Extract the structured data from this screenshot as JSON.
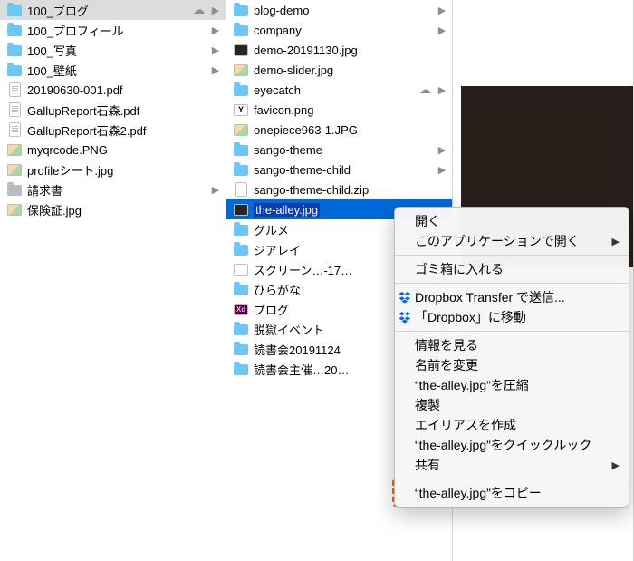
{
  "col1": {
    "items": [
      {
        "type": "folder",
        "label": "100_ブログ",
        "cloud": true,
        "arrow": true,
        "selected": "gray"
      },
      {
        "type": "folder",
        "label": "100_プロフィール",
        "arrow": true
      },
      {
        "type": "folder",
        "label": "100_写真",
        "arrow": true
      },
      {
        "type": "folder",
        "label": "100_壁紙",
        "arrow": true
      },
      {
        "type": "file",
        "label": "20190630-001.pdf"
      },
      {
        "type": "file",
        "label": "GallupReport石森.pdf"
      },
      {
        "type": "file",
        "label": "GallupReport石森2.pdf"
      },
      {
        "type": "img",
        "label": "myqrcode.PNG"
      },
      {
        "type": "img",
        "label": "profileシート.jpg"
      },
      {
        "type": "folder-gray",
        "label": "請求書",
        "arrow": true
      },
      {
        "type": "img",
        "label": "保険証.jpg"
      }
    ]
  },
  "col2": {
    "items": [
      {
        "type": "folder",
        "label": "blog-demo",
        "arrow": true
      },
      {
        "type": "folder",
        "label": "company",
        "arrow": true
      },
      {
        "type": "img-dark",
        "label": "demo-20191130.jpg"
      },
      {
        "type": "img",
        "label": "demo-slider.jpg"
      },
      {
        "type": "folder",
        "label": "eyecatch",
        "cloud": true,
        "arrow": true
      },
      {
        "type": "favicon",
        "label": "favicon.png"
      },
      {
        "type": "img",
        "label": "onepiece963-1.JPG"
      },
      {
        "type": "folder",
        "label": "sango-theme",
        "arrow": true
      },
      {
        "type": "folder",
        "label": "sango-theme-child",
        "arrow": true
      },
      {
        "type": "zip",
        "label": "sango-theme-child.zip"
      },
      {
        "type": "img-dark",
        "label": "the-alley.jpg",
        "arrow": true,
        "selected": "blue"
      },
      {
        "type": "folder",
        "label": "グルメ",
        "arrow": true
      },
      {
        "type": "folder",
        "label": "ジアレイ",
        "arrow": true
      },
      {
        "type": "img-white",
        "label": "スクリーン…-17…"
      },
      {
        "type": "folder",
        "label": "ひらがな",
        "arrow": true
      },
      {
        "type": "xd",
        "label": "ブログ"
      },
      {
        "type": "folder",
        "label": "脱獄イベント",
        "arrow": true
      },
      {
        "type": "folder",
        "label": "読書会20191124",
        "arrow": true
      },
      {
        "type": "folder",
        "label": "読書会主催…20…",
        "arrow": true
      }
    ]
  },
  "menu": {
    "items": [
      {
        "label": "開く"
      },
      {
        "label": "このアプリケーションで開く",
        "arrow": true
      },
      {
        "sep": true
      },
      {
        "label": "ゴミ箱に入れる"
      },
      {
        "sep": true
      },
      {
        "label": "Dropbox Transfer で送信...",
        "icon": "dropbox"
      },
      {
        "label": "「Dropbox」に移動",
        "icon": "dropbox"
      },
      {
        "sep": true
      },
      {
        "label": "情報を見る"
      },
      {
        "label": "名前を変更"
      },
      {
        "label": "“the-alley.jpg”を圧縮"
      },
      {
        "label": "複製"
      },
      {
        "label": "エイリアスを作成"
      },
      {
        "label": "“the-alley.jpg”をクイックルック"
      },
      {
        "label": "共有",
        "arrow": true
      },
      {
        "sep": true
      },
      {
        "label": "“the-alley.jpg”をコピー",
        "highlight": true
      }
    ]
  }
}
